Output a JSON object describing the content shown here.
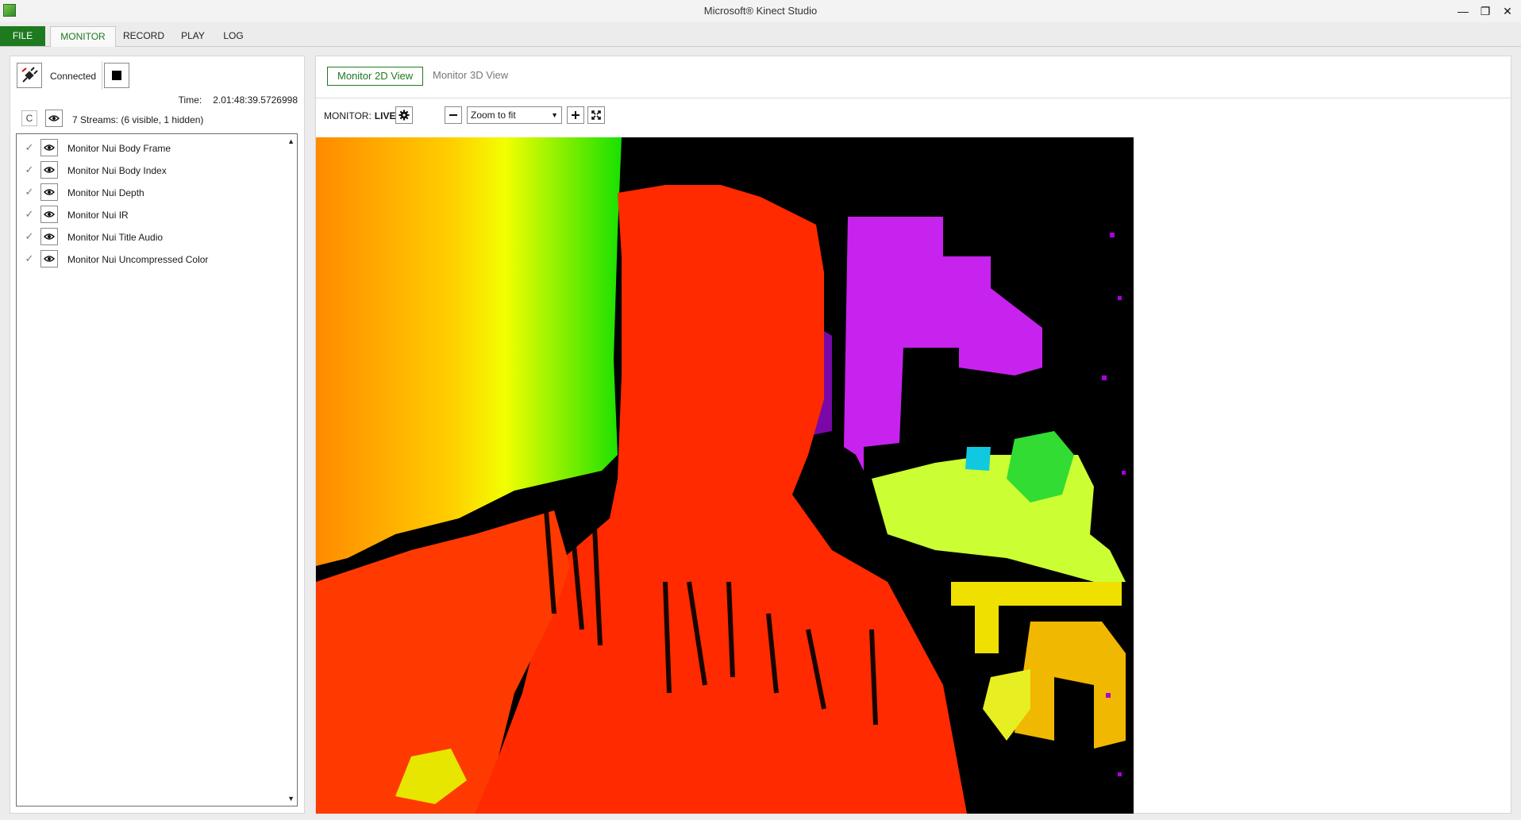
{
  "window": {
    "title": "Microsoft® Kinect Studio"
  },
  "menu": {
    "file": "FILE",
    "tabs": [
      "MONITOR",
      "RECORD",
      "PLAY",
      "LOG"
    ],
    "active_tab": "MONITOR"
  },
  "connection": {
    "status": "Connected",
    "time_label": "Time:",
    "time_value": "2.01:48:39.5726998"
  },
  "streams": {
    "filter_label": "C",
    "summary": "7 Streams: (6 visible, 1 hidden)",
    "items": [
      {
        "name": "Monitor Nui Body Frame",
        "checked": true
      },
      {
        "name": "Monitor Nui Body Index",
        "checked": true
      },
      {
        "name": "Monitor Nui Depth",
        "checked": true
      },
      {
        "name": "Monitor Nui IR",
        "checked": true
      },
      {
        "name": "Monitor Nui Title Audio",
        "checked": true
      },
      {
        "name": "Monitor Nui Uncompressed Color",
        "checked": true
      }
    ]
  },
  "view": {
    "tabs": [
      "Monitor 2D View",
      "Monitor 3D View"
    ],
    "active_tab": "Monitor 2D View",
    "monitor_label": "MONITOR:",
    "monitor_state": "LIVE",
    "zoom_value": "Zoom to fit"
  },
  "colors": {
    "accent": "#1f7a1f",
    "depth_near": "#ff2a00",
    "depth_far": "#bb00ff"
  }
}
